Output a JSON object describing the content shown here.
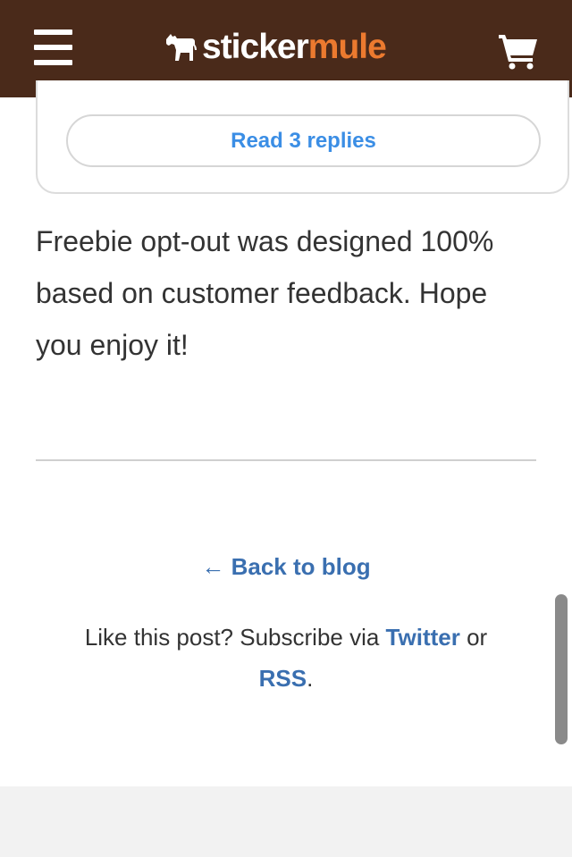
{
  "header": {
    "logo_sticker": "sticker",
    "logo_mule": "mule",
    "colors": {
      "bar": "#4a2a1a",
      "logo_accent": "#ec7a2f"
    },
    "icons": [
      "menu-icon",
      "mule-logo-icon",
      "cart-icon"
    ]
  },
  "comment": {
    "replies_label": "Read 3 replies"
  },
  "post": {
    "body": "Freebie opt-out was designed 100% based on customer feedback. Hope you enjoy it!"
  },
  "footer": {
    "back_label": "← Back to blog",
    "subscribe_prefix": "Like this post? Subscribe via ",
    "twitter_label": "Twitter",
    "or_text": " or ",
    "rss_label": "RSS",
    "period": ".",
    "link_color": "#3a6fb0"
  }
}
